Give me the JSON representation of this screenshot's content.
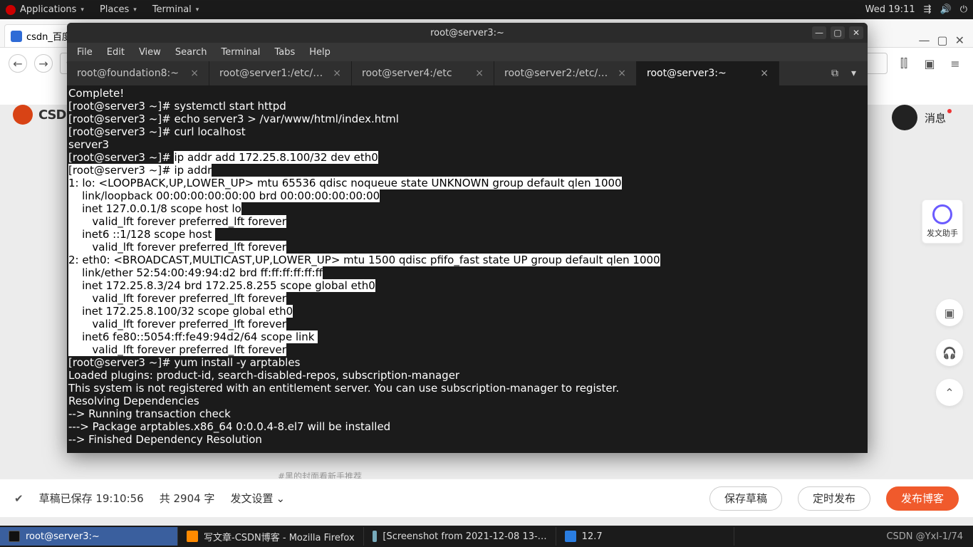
{
  "topbar": {
    "applications": "Applications",
    "places": "Places",
    "terminal": "Terminal",
    "clock": "Wed 19:11"
  },
  "browser": {
    "tab_title": "csdn_百度",
    "addr": "C",
    "menu_icons": {
      "lib": "⫿⫿",
      "reader": "▣",
      "burger": "≡"
    }
  },
  "csdn": {
    "logo": "CSDN",
    "msg": "消息",
    "assistant": "发文助手"
  },
  "terminal": {
    "title": "root@server3:~",
    "menus": [
      "File",
      "Edit",
      "View",
      "Search",
      "Terminal",
      "Tabs",
      "Help"
    ],
    "tabs": [
      {
        "label": "root@foundation8:~",
        "active": false
      },
      {
        "label": "root@server1:/etc/…",
        "active": false
      },
      {
        "label": "root@server4:/etc",
        "active": false
      },
      {
        "label": "root@server2:/etc/…",
        "active": false
      },
      {
        "label": "root@server3:~",
        "active": true
      }
    ],
    "pre_sel": "Complete!\n[root@server3 ~]# systemctl start httpd\n[root@server3 ~]# echo server3 > /var/www/html/index.html\n[root@server3 ~]# curl localhost\nserver3\n[root@server3 ~]# ",
    "sel": "ip addr add 172.25.8.100/32 dev eth0\n[root@server3 ~]# ip addr\n1: lo: <LOOPBACK,UP,LOWER_UP> mtu 65536 qdisc noqueue state UNKNOWN group default qlen 1000\n    link/loopback 00:00:00:00:00:00 brd 00:00:00:00:00:00\n    inet 127.0.0.1/8 scope host lo\n       valid_lft forever preferred_lft forever\n    inet6 ::1/128 scope host \n       valid_lft forever preferred_lft forever\n2: eth0: <BROADCAST,MULTICAST,UP,LOWER_UP> mtu 1500 qdisc pfifo_fast state UP group default qlen 1000\n    link/ether 52:54:00:49:94:d2 brd ff:ff:ff:ff:ff:ff\n    inet 172.25.8.3/24 brd 172.25.8.255 scope global eth0\n       valid_lft forever preferred_lft forever\n    inet 172.25.8.100/32 scope global eth0\n       valid_lft forever preferred_lft forever\n    inet6 fe80::5054:ff:fe49:94d2/64 scope link \n       valid_lft forever preferred_lft forever",
    "post_sel": "\n[root@server3 ~]# yum install -y arptables\nLoaded plugins: product-id, search-disabled-repos, subscription-manager\nThis system is not registered with an entitlement server. You can use subscription-manager to register.\nResolving Dependencies\n--> Running transaction check\n---> Package arptables.x86_64 0:0.0.4-8.el7 will be installed\n--> Finished Dependency Resolution\n"
  },
  "editor": {
    "saved": "草稿已保存 19:10:56",
    "wordcount": "共 2904 字",
    "settings": "发文设置",
    "save_draft": "保存草稿",
    "schedule": "定时发布",
    "publish": "发布博客",
    "truncated": "#黑的封面看新手推荐"
  },
  "taskbar": {
    "t1": "root@server3:~",
    "t2": "写文章-CSDN博客 - Mozilla Firefox",
    "t3": "[Screenshot from 2021-12-08 13-…",
    "t4": "12.7",
    "watermark": "CSDN @YxI-1/74"
  }
}
